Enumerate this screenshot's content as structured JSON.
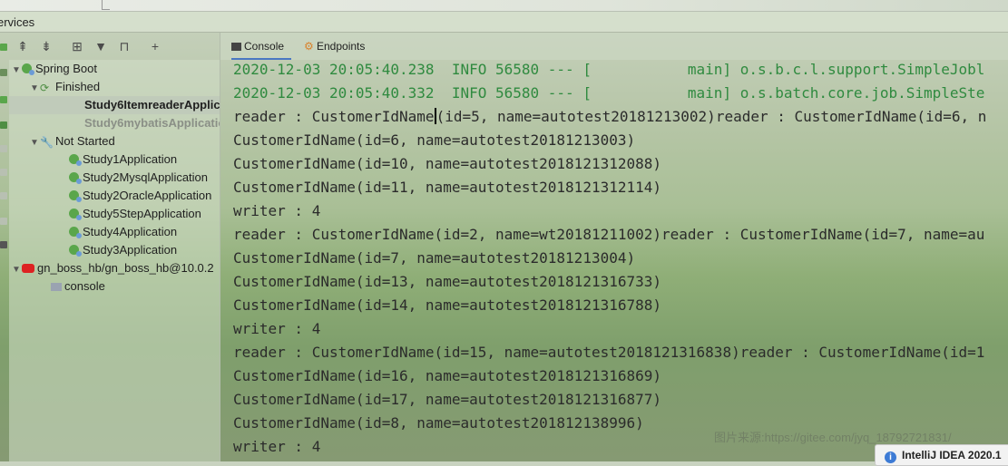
{
  "window": {
    "title": "ervices"
  },
  "tabs": [
    {
      "label": "Console",
      "icon": "console-icon"
    },
    {
      "label": "Endpoints",
      "icon": "endpoints-icon"
    }
  ],
  "tree": {
    "spring_boot": "Spring Boot",
    "finished": "Finished",
    "finished_items": [
      "Study6ItemreaderApplic",
      "Study6mybatisApplicatio"
    ],
    "not_started": "Not Started",
    "not_started_items": [
      "Study1Application",
      "Study2MysqlApplication",
      "Study2OracleApplication",
      "Study5StepApplication",
      "Study4Application",
      "Study3Application"
    ],
    "db": "gn_boss_hb/gn_boss_hb@10.0.2",
    "db_console": "console"
  },
  "console": {
    "lines": [
      "2020-12-03 20:05:40.238  INFO 56580 --- [           main] o.s.b.c.l.support.SimpleJobl",
      "2020-12-03 20:05:40.332  INFO 56580 --- [           main] o.s.batch.core.job.SimpleSte",
      "(id=5, name=autotest20181213002)reader : CustomerIdName(id=6, n",
      "CustomerIdName(id=6, name=autotest20181213003)",
      "CustomerIdName(id=10, name=autotest2018121312088)",
      "CustomerIdName(id=11, name=autotest2018121312114)",
      "writer : 4",
      "reader : CustomerIdName(id=2, name=wt20181211002)reader : CustomerIdName(id=7, name=au",
      "CustomerIdName(id=7, name=autotest20181213004)",
      "CustomerIdName(id=13, name=autotest2018121316733)",
      "CustomerIdName(id=14, name=autotest2018121316788)",
      "writer : 4",
      "reader : CustomerIdName(id=15, name=autotest2018121316838)reader : CustomerIdName(id=1",
      "CustomerIdName(id=16, name=autotest2018121316869)",
      "CustomerIdName(id=17, name=autotest2018121316877)",
      "CustomerIdName(id=8, name=autotest201812138996)",
      "writer : 4"
    ],
    "line3_prefix": "reader : CustomerIdName"
  },
  "watermark": "图片来源:https://gitee.com/jyq_18792721831/",
  "notification": "IntelliJ IDEA 2020.1",
  "colors": {
    "log_green": "#2f8a3f",
    "accent": "#4a78c2"
  }
}
